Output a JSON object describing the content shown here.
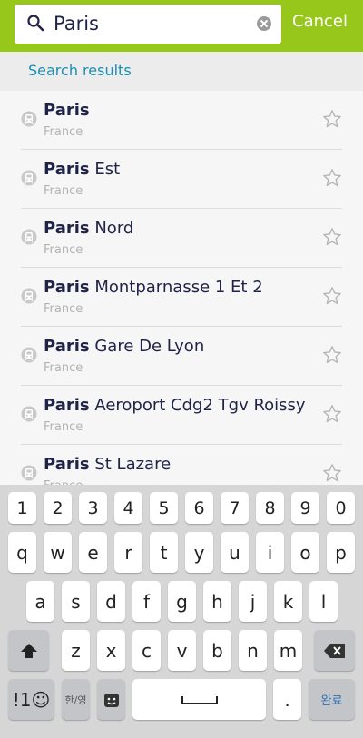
{
  "search": {
    "value": "Paris",
    "cancel_label": "Cancel"
  },
  "section": {
    "title": "Search results"
  },
  "results": [
    {
      "bold": "Paris",
      "rest": "",
      "country": "France"
    },
    {
      "bold": "Paris",
      "rest": " Est",
      "country": "France"
    },
    {
      "bold": "Paris",
      "rest": " Nord",
      "country": "France"
    },
    {
      "bold": "Paris",
      "rest": " Montparnasse 1 Et 2",
      "country": "France"
    },
    {
      "bold": "Paris",
      "rest": " Gare De Lyon",
      "country": "France"
    },
    {
      "bold": "Paris",
      "rest": " Aeroport Cdg2 Tgv Roissy",
      "country": "France"
    },
    {
      "bold": "Paris",
      "rest": " St Lazare",
      "country": "France"
    }
  ],
  "keyboard": {
    "numbers": [
      "1",
      "2",
      "3",
      "4",
      "5",
      "6",
      "7",
      "8",
      "9",
      "0"
    ],
    "row1": [
      "q",
      "w",
      "e",
      "r",
      "t",
      "y",
      "u",
      "i",
      "o",
      "p"
    ],
    "row2": [
      "a",
      "s",
      "d",
      "f",
      "g",
      "h",
      "j",
      "k",
      "l"
    ],
    "row3": [
      "z",
      "x",
      "c",
      "v",
      "b",
      "n",
      "m"
    ],
    "symbols_label": "!1☺",
    "lang_label": "한/영",
    "period_label": ".",
    "done_label": "완료"
  },
  "colors": {
    "accent": "#96c71a",
    "link": "#1a8fb3",
    "text": "#1e2347"
  }
}
